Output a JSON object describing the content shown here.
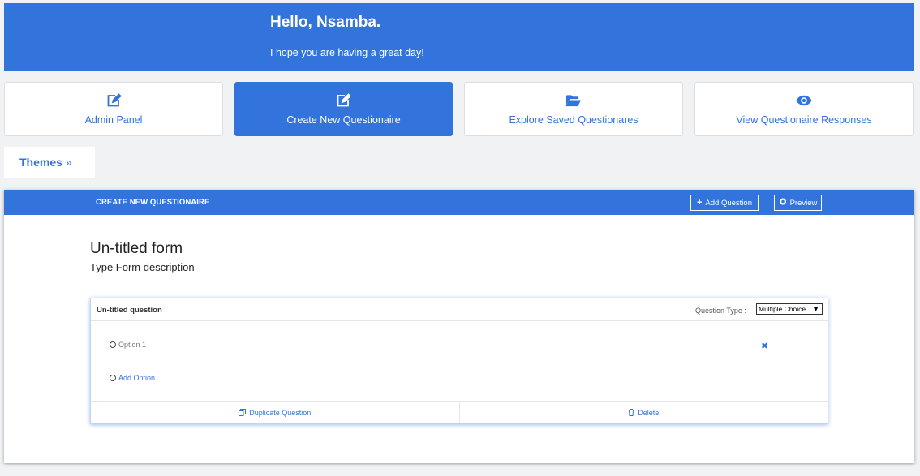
{
  "header": {
    "greeting": "Hello, Nsamba.",
    "subtitle": "I hope you are having a great day!"
  },
  "nav": [
    {
      "label": "Admin Panel",
      "icon": "edit-icon"
    },
    {
      "label": "Create New Questionaire",
      "icon": "edit-icon",
      "active": true
    },
    {
      "label": "Explore Saved Questionares",
      "icon": "folder-open-icon"
    },
    {
      "label": "View Questionaire Responses",
      "icon": "eye-icon"
    }
  ],
  "themes": {
    "label": "Themes",
    "icon": "double-chevron-right-icon"
  },
  "panel": {
    "title": "CREATE NEW QUESTIONAIRE",
    "add_question_label": "Add Question",
    "preview_label": "Preview"
  },
  "form": {
    "title": "Un-titled form",
    "description": "Type Form description"
  },
  "question": {
    "title": "Un-titled question",
    "type_label": "Question Type :",
    "type_value": "Multiple Choice",
    "options": [
      "Option 1"
    ],
    "add_option_label": "Add Option...",
    "duplicate_label": "Duplicate Question",
    "delete_label": "Delete"
  },
  "colors": {
    "accent": "#3273dc",
    "background": "#f0f2f3"
  }
}
